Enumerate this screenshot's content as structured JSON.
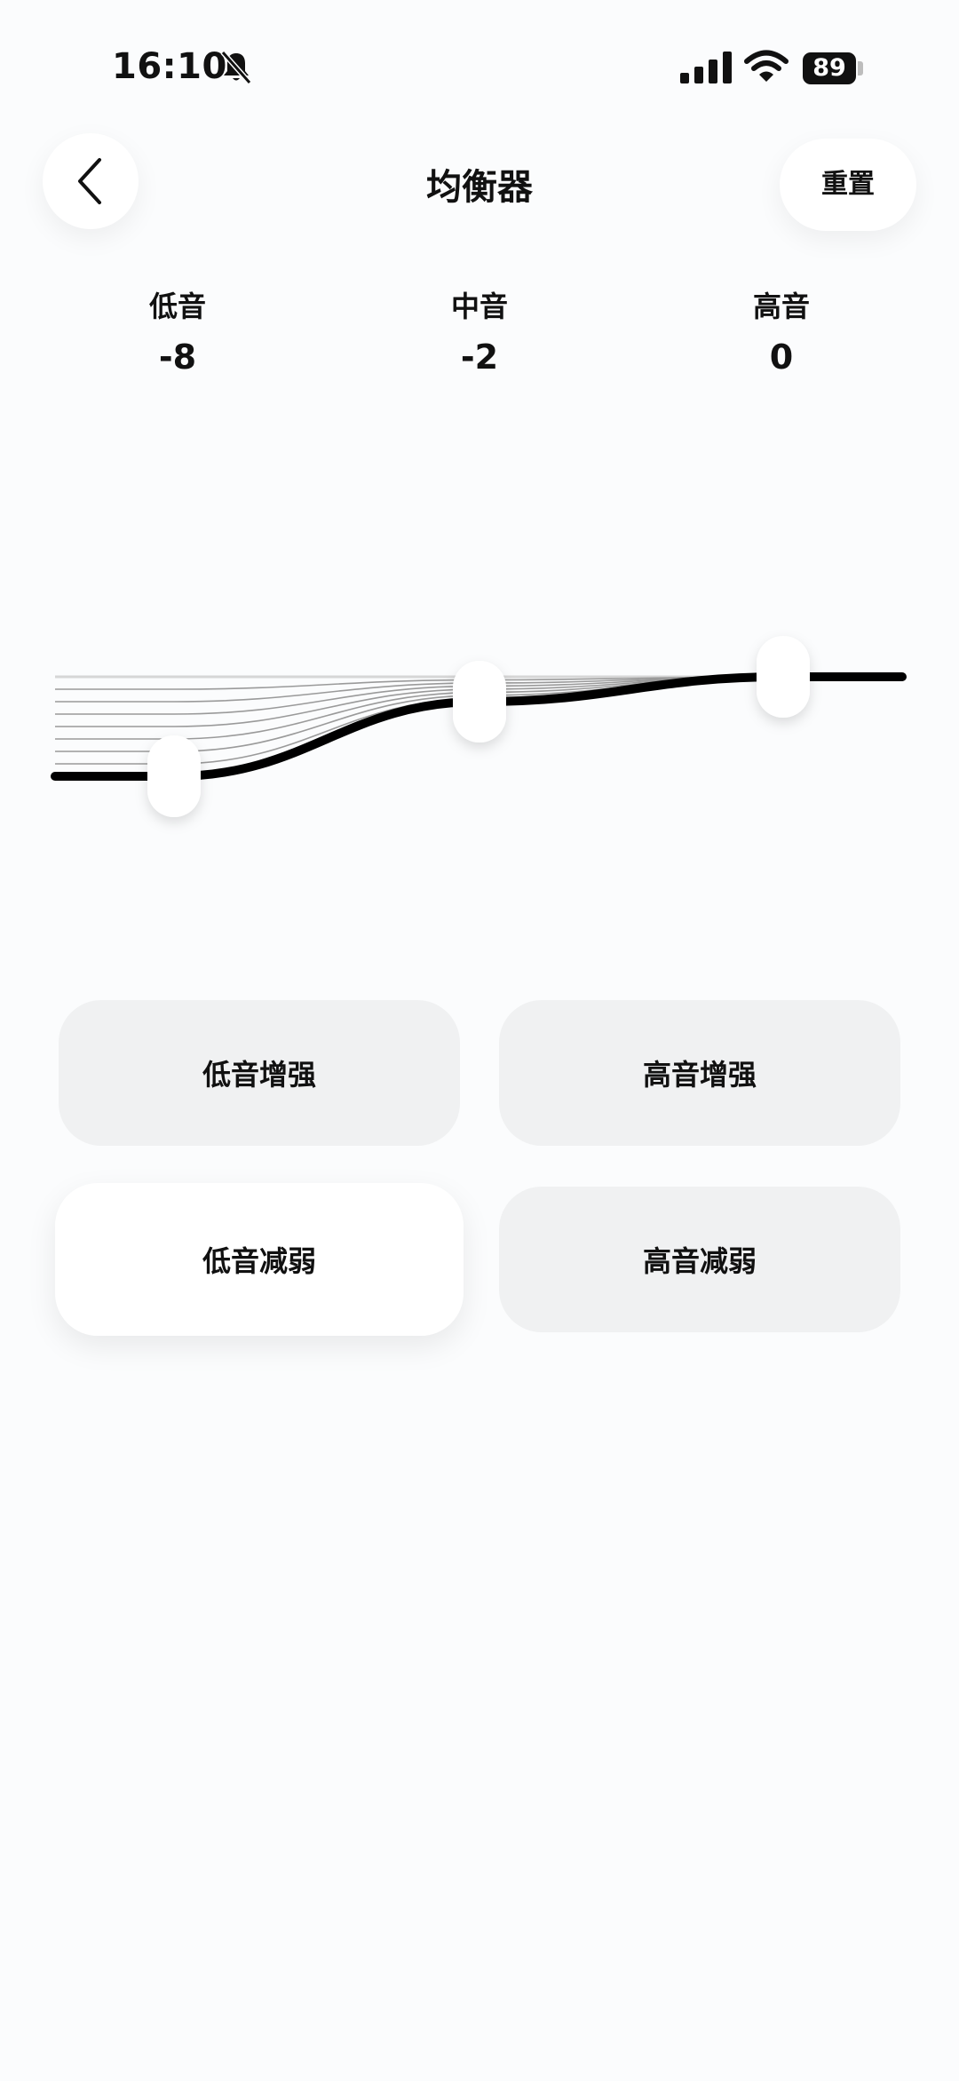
{
  "status_bar": {
    "time": "16:10",
    "battery": "89",
    "icons": [
      "bell-muted-icon",
      "cellular-signal-icon",
      "wifi-icon",
      "battery-icon"
    ]
  },
  "header": {
    "title": "均衡器",
    "back_icon": "chevron-left-icon",
    "reset_label": "重置"
  },
  "bands": [
    {
      "label": "低音",
      "value": "-8",
      "level": -8
    },
    {
      "label": "中音",
      "value": "-2",
      "level": -2
    },
    {
      "label": "高音",
      "value": "0",
      "level": 0
    }
  ],
  "presets": [
    {
      "label": "低音增强",
      "selected": false
    },
    {
      "label": "高音增强",
      "selected": false
    },
    {
      "label": "低音减弱",
      "selected": true
    },
    {
      "label": "高音减弱",
      "selected": false
    }
  ],
  "colors": {
    "background": "#fbfcfd",
    "text": "#111111",
    "preset_bg": "#f0f1f2",
    "preset_active_bg": "#ffffff"
  }
}
